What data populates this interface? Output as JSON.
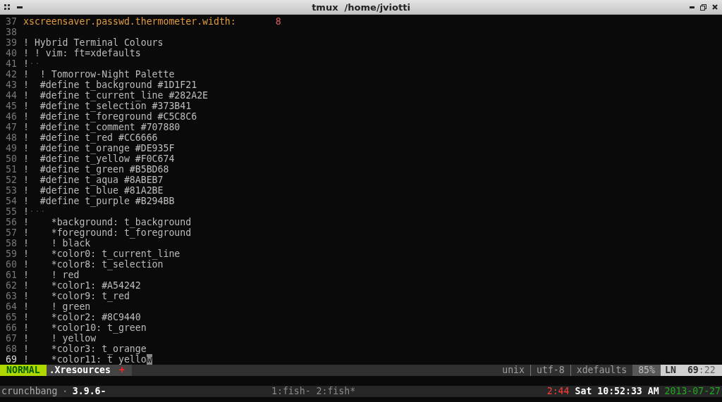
{
  "window": {
    "title": "tmux  /home/jviotti"
  },
  "editor": {
    "lines": [
      {
        "number": "37",
        "kind": "setting",
        "key": "xscreensaver.passwd.thermometer.width:",
        "value": "8"
      },
      {
        "number": "38",
        "kind": "blank"
      },
      {
        "number": "39",
        "kind": "comment",
        "text": "! Hybrid Terminal Colours"
      },
      {
        "number": "40",
        "kind": "comment",
        "text": "! ! vim: ft=xdefaults"
      },
      {
        "number": "41",
        "kind": "comment",
        "text": "!",
        "trailing": "··"
      },
      {
        "number": "42",
        "kind": "comment",
        "text": "!  ! Tomorrow-Night Palette"
      },
      {
        "number": "43",
        "kind": "comment",
        "text": "!  #define t_background #1D1F21"
      },
      {
        "number": "44",
        "kind": "comment",
        "text": "!  #define t_current_line #282A2E"
      },
      {
        "number": "45",
        "kind": "comment",
        "text": "!  #define t_selection #373B41"
      },
      {
        "number": "46",
        "kind": "comment",
        "text": "!  #define t_foreground #C5C8C6"
      },
      {
        "number": "47",
        "kind": "comment",
        "text": "!  #define t_comment #707880"
      },
      {
        "number": "48",
        "kind": "comment",
        "text": "!  #define t_red #CC6666"
      },
      {
        "number": "49",
        "kind": "comment",
        "text": "!  #define t_orange #DE935F"
      },
      {
        "number": "50",
        "kind": "comment",
        "text": "!  #define t_yellow #F0C674"
      },
      {
        "number": "51",
        "kind": "comment",
        "text": "!  #define t_green #B5BD68"
      },
      {
        "number": "52",
        "kind": "comment",
        "text": "!  #define t_aqua #8ABEB7"
      },
      {
        "number": "53",
        "kind": "comment",
        "text": "!  #define t_blue #81A2BE"
      },
      {
        "number": "54",
        "kind": "comment",
        "text": "!  #define t_purple #B294BB"
      },
      {
        "number": "55",
        "kind": "comment",
        "text": "!",
        "trailing": "···"
      },
      {
        "number": "56",
        "kind": "comment",
        "text": "!    *background: t_background"
      },
      {
        "number": "57",
        "kind": "comment",
        "text": "!    *foreground: t_foreground"
      },
      {
        "number": "58",
        "kind": "comment",
        "text": "!    ! black"
      },
      {
        "number": "59",
        "kind": "comment",
        "text": "!    *color0: t_current_line"
      },
      {
        "number": "60",
        "kind": "comment",
        "text": "!    *color8: t_selection"
      },
      {
        "number": "61",
        "kind": "comment",
        "text": "!    ! red"
      },
      {
        "number": "62",
        "kind": "comment",
        "text": "!    *color1: #A54242"
      },
      {
        "number": "63",
        "kind": "comment",
        "text": "!    *color9: t_red"
      },
      {
        "number": "64",
        "kind": "comment",
        "text": "!    ! green"
      },
      {
        "number": "65",
        "kind": "comment",
        "text": "!    *color2: #8C9440"
      },
      {
        "number": "66",
        "kind": "comment",
        "text": "!    *color10: t_green"
      },
      {
        "number": "67",
        "kind": "comment",
        "text": "!    ! yellow"
      },
      {
        "number": "68",
        "kind": "comment",
        "text": "!    *color3: t_orange"
      },
      {
        "number": "69",
        "kind": "comment",
        "text": "!    *color11: t_yello",
        "cursor": "w",
        "current": true
      }
    ]
  },
  "statusline": {
    "mode": "NORMAL",
    "file": ".Xresources",
    "modified_mark": "+",
    "fileformat": "unix",
    "encoding": "utf-8",
    "filetype": "xdefaults",
    "percent": "85%",
    "ln_label": "LN",
    "line": "69",
    "column": ":22"
  },
  "tmux_bar": {
    "session": "crunchbang",
    "separator": "•",
    "version": "3.9.6-",
    "windows": "1:fish- 2:fish*",
    "uptime": "2:44",
    "day_time": "Sat 10:52:33 AM",
    "date": "2013-07-27"
  }
}
